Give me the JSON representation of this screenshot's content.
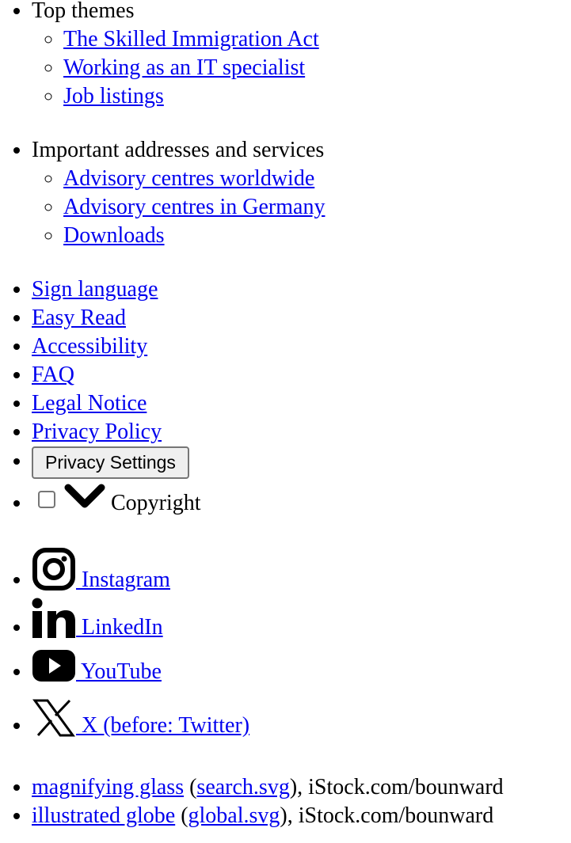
{
  "top_themes": {
    "heading": "Top themes",
    "links": [
      "The Skilled Immigration Act",
      "Working as an IT specialist",
      "Job listings"
    ]
  },
  "addresses": {
    "heading": "Important addresses and services",
    "links": [
      "Advisory centres worldwide",
      "Advisory centres in Germany",
      "Downloads"
    ]
  },
  "footer_links": [
    "Sign language",
    "Easy Read",
    "Accessibility",
    "FAQ",
    "Legal Notice",
    "Privacy Policy"
  ],
  "privacy_button": "Privacy Settings",
  "copyright_label": "Copyright",
  "social": [
    {
      "label": " Instagram",
      "icon": "instagram-icon"
    },
    {
      "label": " LinkedIn",
      "icon": "linkedin-icon"
    },
    {
      "label": " YouTube",
      "icon": "youtube-icon"
    },
    {
      "label": " X (before: Twitter)",
      "icon": "x-twitter-icon"
    }
  ],
  "credits": [
    {
      "link": "magnifying glass",
      "file": "search.svg",
      "source": ", iStock.com/bounward"
    },
    {
      "link": "illustrated globe",
      "file": "global.svg",
      "source": ", iStock.com/bounward"
    }
  ]
}
